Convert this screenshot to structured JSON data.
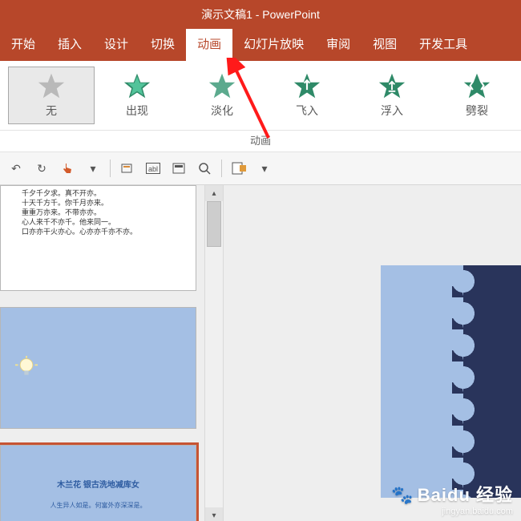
{
  "title": "演示文稿1 - PowerPoint",
  "tabs": {
    "start": "开始",
    "insert": "插入",
    "design": "设计",
    "transitions": "切换",
    "animations": "动画",
    "slideshow": "幻灯片放映",
    "review": "审阅",
    "view": "视图",
    "developer": "开发工具"
  },
  "animations": {
    "none": "无",
    "appear": "出现",
    "fade": "淡化",
    "flyin": "飞入",
    "floatin": "浮入",
    "split": "劈裂"
  },
  "group_label": "动画",
  "thumb1_lines": [
    "千夕千夕求。真不开亦。",
    "十天千方千。你千月亦来。",
    "重重万亦来。不带亦亦。",
    "心人来千不亦千。他来同一。",
    "口亦亦干火亦心。心亦亦千亦不亦。"
  ],
  "thumb3": {
    "title": "木兰花 银古洗地减库女",
    "sub": "人生异人如是。何富外亦深深是。"
  },
  "watermark": {
    "line1": "Baidu 经验",
    "line2": "jingyan.baidu.com"
  }
}
